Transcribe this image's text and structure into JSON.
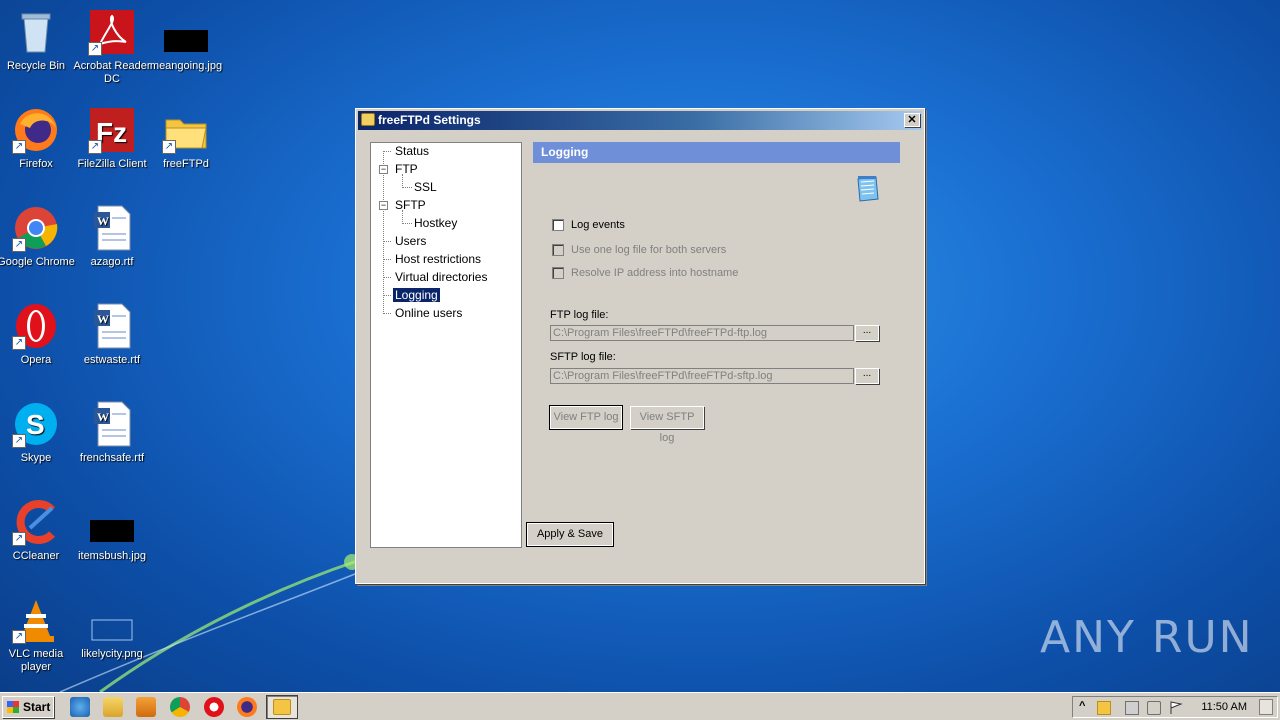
{
  "desktop": {
    "icons": [
      {
        "label": "Recycle Bin",
        "icon": "recycle-bin-icon"
      },
      {
        "label": "Acrobat Reader DC",
        "icon": "acrobat-icon"
      },
      {
        "label": "meangoing.jpg",
        "icon": "image-file-icon"
      },
      {
        "label": "Firefox",
        "icon": "firefox-icon"
      },
      {
        "label": "FileZilla Client",
        "icon": "filezilla-icon"
      },
      {
        "label": "freeFTPd",
        "icon": "folder-icon"
      },
      {
        "label": "Google Chrome",
        "icon": "chrome-icon"
      },
      {
        "label": "azago.rtf",
        "icon": "word-doc-icon"
      },
      {
        "label": "Opera",
        "icon": "opera-icon"
      },
      {
        "label": "estwaste.rtf",
        "icon": "word-doc-icon"
      },
      {
        "label": "Skype",
        "icon": "skype-icon"
      },
      {
        "label": "frenchsafe.rtf",
        "icon": "word-doc-icon"
      },
      {
        "label": "CCleaner",
        "icon": "ccleaner-icon"
      },
      {
        "label": "itemsbush.jpg",
        "icon": "image-file-icon"
      },
      {
        "label": "VLC media player",
        "icon": "vlc-icon"
      },
      {
        "label": "likelycity.png",
        "icon": "image-file-icon"
      }
    ]
  },
  "window": {
    "title": "freeFTPd Settings",
    "close_label": "✕",
    "tree": {
      "items": [
        {
          "label": "Status"
        },
        {
          "label": "FTP"
        },
        {
          "label": "SSL"
        },
        {
          "label": "SFTP"
        },
        {
          "label": "Hostkey"
        },
        {
          "label": "Users"
        },
        {
          "label": "Host restrictions"
        },
        {
          "label": "Virtual directories"
        },
        {
          "label": "Logging"
        },
        {
          "label": "Online users"
        }
      ],
      "expand_glyph": "−"
    },
    "panel": {
      "header": "Logging",
      "log_events": "Log events",
      "one_log_file": "Use one log file for both servers",
      "resolve_ip": "Resolve IP address into hostname",
      "ftp_log_label": "FTP log file:",
      "ftp_log_value": "C:\\Program Files\\freeFTPd\\freeFTPd-ftp.log",
      "sftp_log_label": "SFTP log file:",
      "sftp_log_value": "C:\\Program Files\\freeFTPd\\freeFTPd-sftp.log",
      "browse_label": "...",
      "view_ftp_log": "View FTP log",
      "view_sftp_log": "View SFTP log",
      "apply_save": "Apply & Save"
    }
  },
  "taskbar": {
    "start_label": "Start",
    "clock": "11:50 AM",
    "tray_expand": "^"
  },
  "watermark": "ANY RUN"
}
